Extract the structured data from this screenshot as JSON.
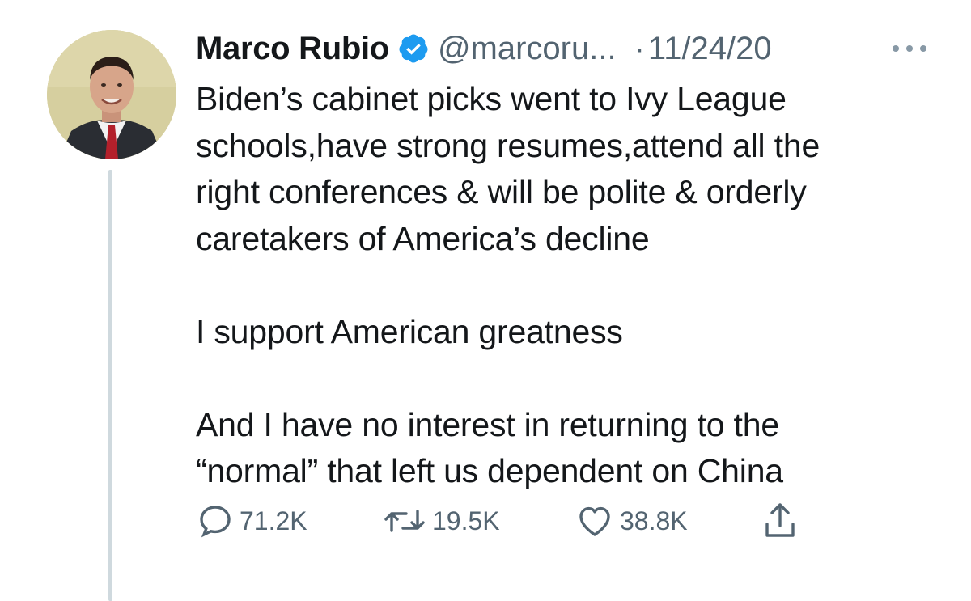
{
  "author": {
    "name": "Marco Rubio",
    "handle": "@marcoru...",
    "separator": "·",
    "date": "11/24/20",
    "verified": true
  },
  "tweet": {
    "paragraphs": [
      "Biden’s cabinet picks went to Ivy League\nschools,have strong resumes,attend all the\nright conferences & will be polite & orderly\ncaretakers of America’s decline",
      "I support American greatness",
      "And I have no interest in returning to the\n“normal” that left us dependent on China"
    ]
  },
  "actions": {
    "replies": "71.2K",
    "retweets": "19.5K",
    "likes": "38.8K"
  },
  "icons": {
    "verified": "verified-badge-icon",
    "more": "more-icon",
    "reply": "reply-icon",
    "retweet": "retweet-icon",
    "like": "heart-icon",
    "share": "share-icon"
  },
  "colors": {
    "verified": "#1d9bf0",
    "text": "#14171a",
    "secondary": "#536471",
    "thread_line": "#cfd9de"
  }
}
